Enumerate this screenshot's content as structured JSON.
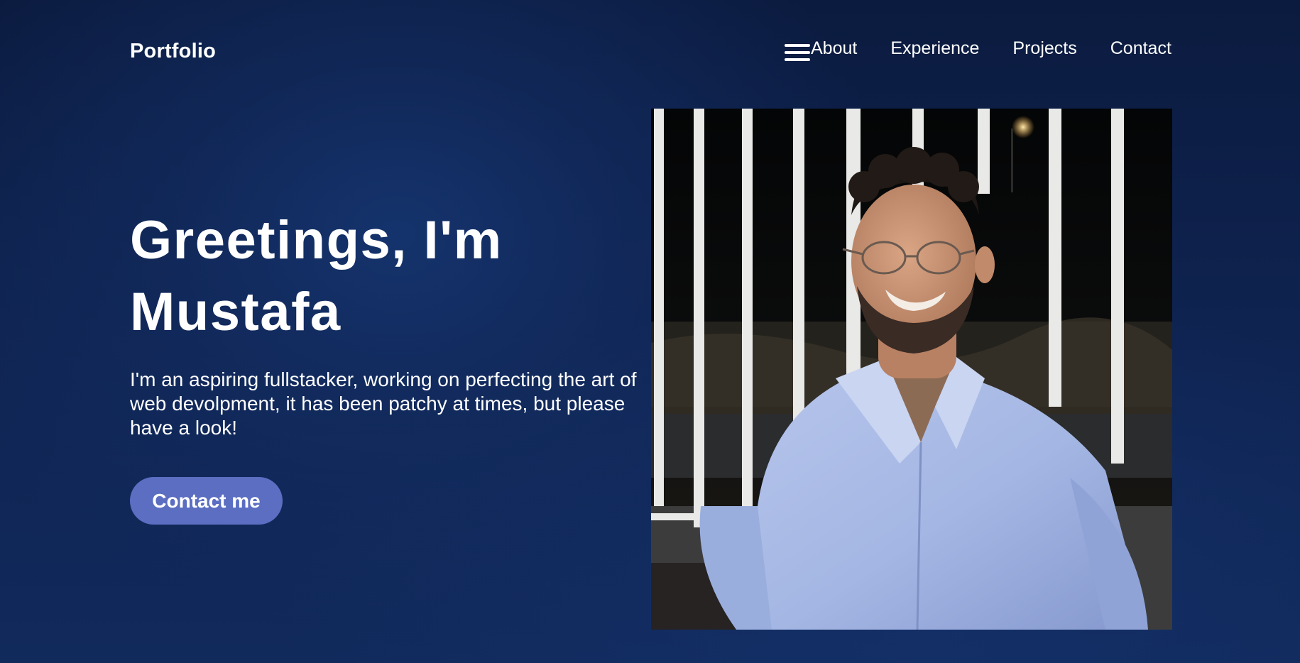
{
  "nav": {
    "brand": "Portfolio",
    "menu_icon": "hamburger-menu-icon",
    "links": [
      "About",
      "Experience",
      "Projects",
      "Contact"
    ]
  },
  "hero": {
    "title_line1": "Greetings, I'm",
    "title_line2": "Mustafa",
    "description": "I'm an aspiring fullstacker, working on perfecting the art of web devolpment, it has been patchy at times, but please have a look!",
    "cta_label": "Contact me",
    "photo_alt": "Mustafa"
  },
  "colors": {
    "background": "#0f2452",
    "button": "#5b6ec2",
    "text": "#ffffff"
  }
}
